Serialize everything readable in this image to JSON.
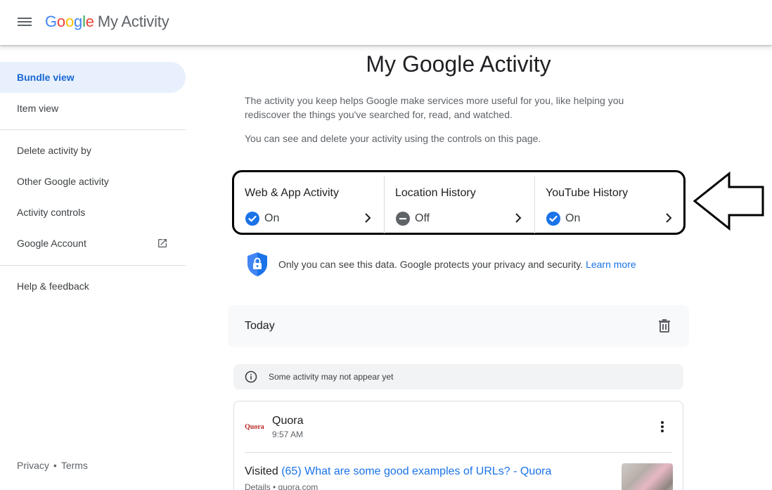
{
  "header": {
    "logo_g": [
      "G",
      "o",
      "o",
      "g",
      "l",
      "e"
    ],
    "product_name": "My Activity"
  },
  "sidebar": {
    "items": [
      {
        "label": "Bundle view"
      },
      {
        "label": "Item view"
      },
      {
        "label": "Delete activity by"
      },
      {
        "label": "Other Google activity"
      },
      {
        "label": "Activity controls"
      },
      {
        "label": "Google Account"
      },
      {
        "label": "Help & feedback"
      }
    ],
    "footer": {
      "privacy": "Privacy",
      "separator": "•",
      "terms": "Terms"
    }
  },
  "main": {
    "title": "My Google Activity",
    "intro": "The activity you keep helps Google make services more useful for you, like helping you rediscover the things you've searched for, read, and watched.",
    "intro2": "You can see and delete your activity using the controls on this page.",
    "controls": [
      {
        "label": "Web & App Activity",
        "status": "On"
      },
      {
        "label": "Location History",
        "status": "Off"
      },
      {
        "label": "YouTube History",
        "status": "On"
      }
    ],
    "privacy_text": "Only you can see this data. Google protects your privacy and security.",
    "privacy_link": "Learn more",
    "today_label": "Today",
    "notice": "Some activity may not appear yet",
    "activity": {
      "source_logo": "Quora",
      "source": "Quora",
      "time": "9:57 AM",
      "visited_prefix": "Visited",
      "visited_link": "(65) What are some good examples of URLs? - Quora",
      "details": "Details • quora.com"
    }
  },
  "colors": {
    "accent": "#1a73e8",
    "active_nav_bg": "#e8f0fe",
    "status_on": "#1a73e8",
    "status_off": "#5f6368",
    "quora_red": "#b92b27"
  },
  "icons": [
    "menu-icon",
    "external-link-icon",
    "check-circle-icon",
    "minus-circle-icon",
    "chevron-right-icon",
    "shield-lock-icon",
    "trash-icon",
    "info-icon",
    "more-vert-icon",
    "arrow-left-icon"
  ]
}
